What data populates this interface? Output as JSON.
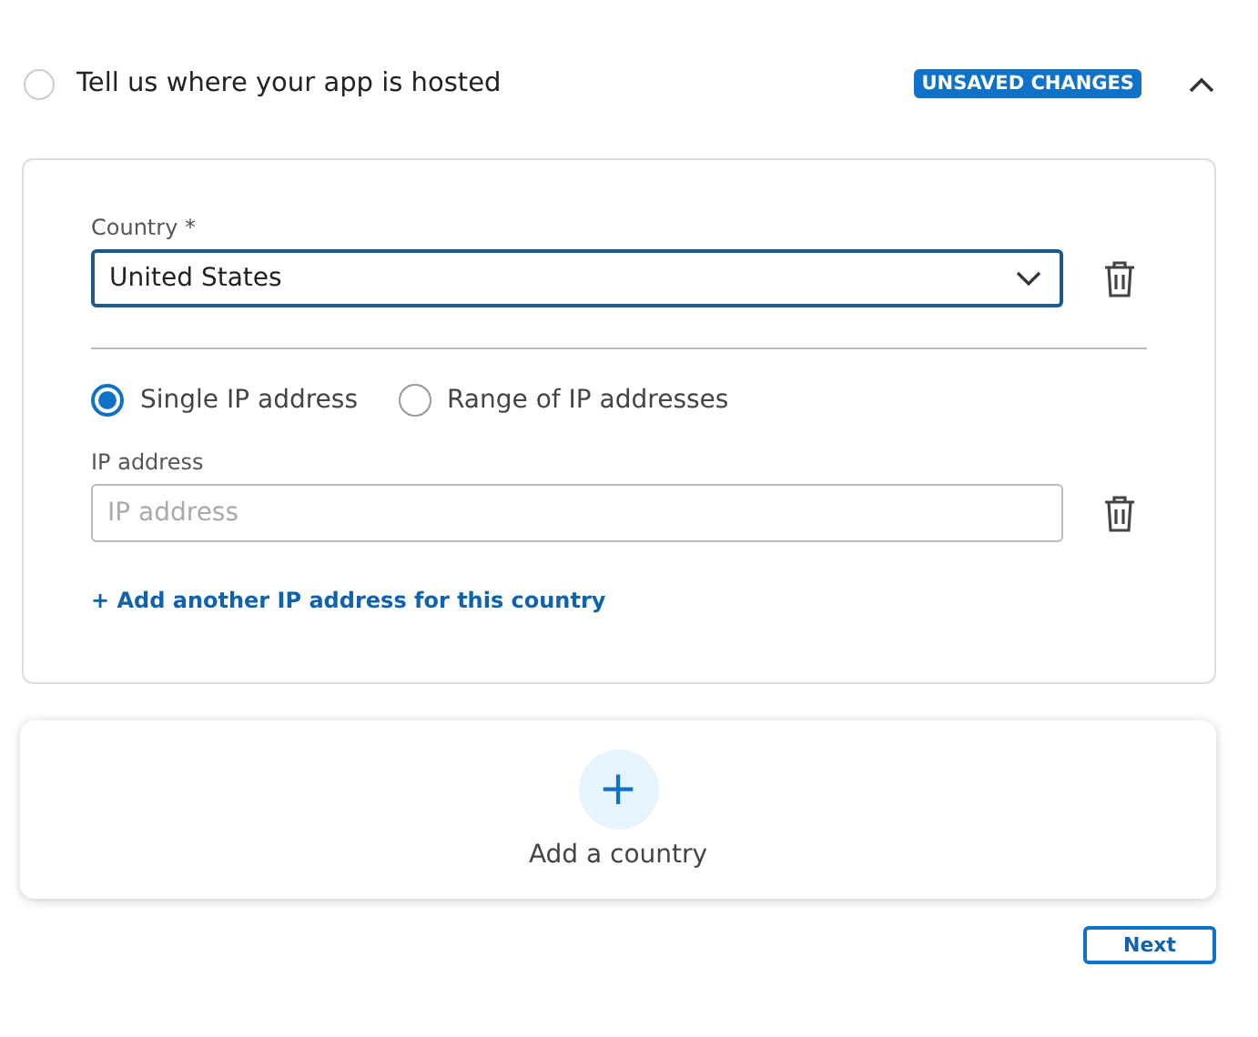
{
  "step": {
    "title": "Tell us where your app is hosted",
    "completed": false,
    "badge": "UNSAVED CHANGES",
    "expanded": true
  },
  "country": {
    "label": "Country *",
    "value": "United States"
  },
  "ip_types": [
    {
      "label": "Single IP address",
      "selected": true
    },
    {
      "label": "Range of IP addresses",
      "selected": false
    }
  ],
  "ip_field": {
    "label": "IP address",
    "placeholder": "IP address"
  },
  "add_ip_link": "+ Add another IP address for this country",
  "add_country": {
    "icon": "+",
    "label": "Add a country"
  },
  "next_button": "Next"
}
